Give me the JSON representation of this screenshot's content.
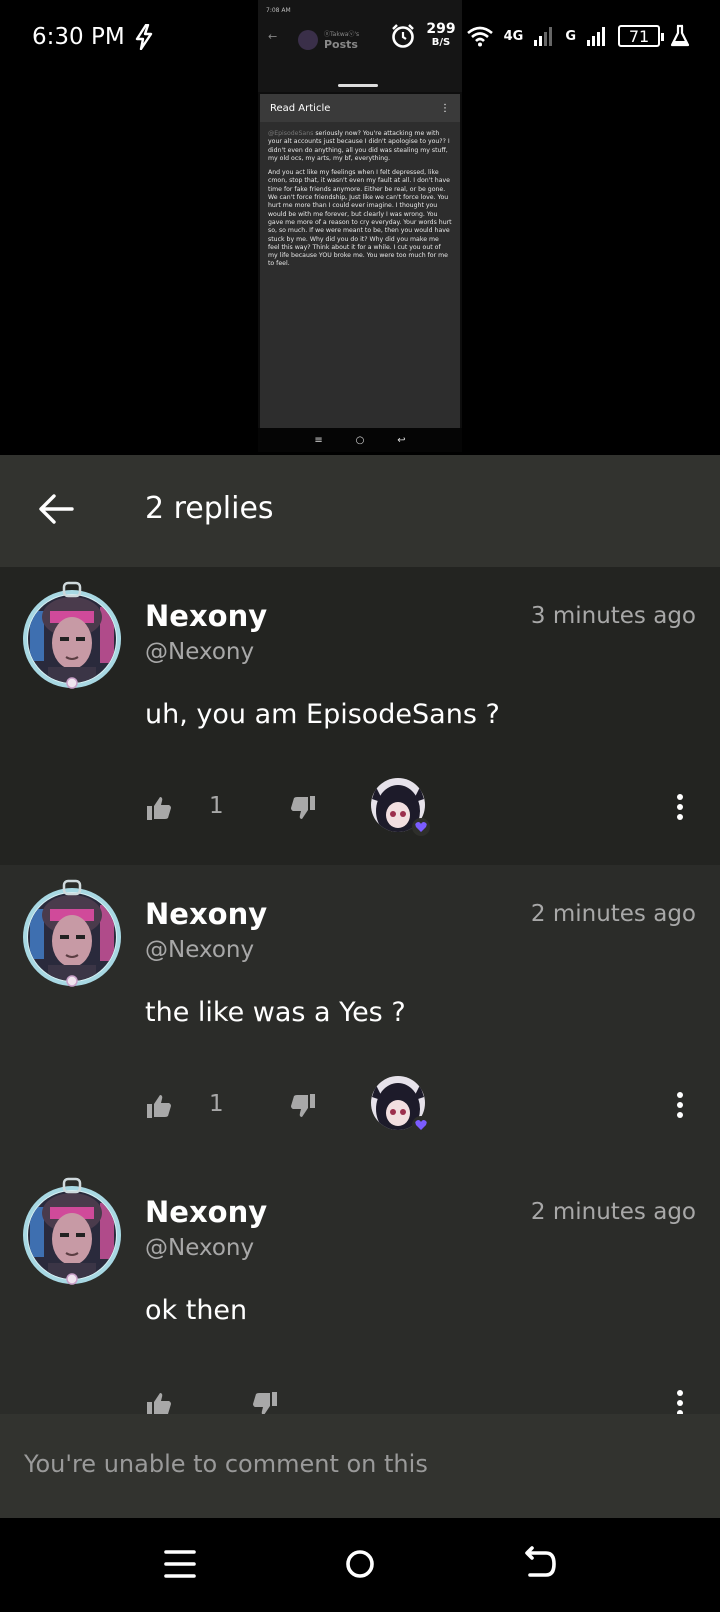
{
  "status_bar": {
    "time": "6:30 PM",
    "speed_value": "299",
    "speed_unit": "B/S",
    "network_4g": "4G",
    "network_g": "G",
    "battery": "71",
    "icons": [
      "charging-bolt-icon",
      "alarm-icon",
      "wifi-icon",
      "signal-icon",
      "battery-icon",
      "flask-icon"
    ]
  },
  "preview": {
    "phone_time": "7:08 AM",
    "phone_subtitle": "ⓞTakwaⓥ's",
    "phone_title": "Posts",
    "article_header": "Read Article",
    "article_mention": "@EpisodeSans",
    "article_p1": "seriously now? You're attacking me with your alt accounts just because I didn't apologise to you?? I didn't even do anything, all you did was stealing my stuff, my old ocs, my arts, my bf, everything.",
    "article_p2": "And you act like my feelings when I felt depressed, like cmon, stop that, it wasn't even my fault at all. I don't have time for fake friends anymore. Either be real, or be gone. We can't force friendship, Just like we can't force love. You hurt me more than I could ever imagine. I thought you would be with me forever, but clearly I was wrong. You gave me more of a reason to cry everyday. Your words hurt so, so much. If we were meant to be, then you would have stuck by me. Why did you do it? Why did you make me feel this way? Think about it for a while. I cut you out of my life because YOU broke me. You were too much for me to feel."
  },
  "header": {
    "title": "2 replies"
  },
  "replies": [
    {
      "name": "Nexony",
      "handle": "@Nexony",
      "time": "3 minutes ago",
      "text": "uh, you am EpisodeSans ?",
      "likes": "1",
      "author_liked": true
    },
    {
      "name": "Nexony",
      "handle": "@Nexony",
      "time": "2 minutes ago",
      "text": "the like was a Yes ?",
      "likes": "1",
      "author_liked": true
    },
    {
      "name": "Nexony",
      "handle": "@Nexony",
      "time": "2 minutes ago",
      "text": "ok then",
      "likes": "",
      "author_liked": false
    }
  ],
  "comment_bar": {
    "text": "You're unable to comment on this"
  },
  "colors": {
    "header_bg": "#32332f",
    "first_reply_bg": "#232421",
    "reply_bg": "#2b2c29",
    "muted_text": "#a8a8a8",
    "heart_purple": "#7b5cff"
  }
}
